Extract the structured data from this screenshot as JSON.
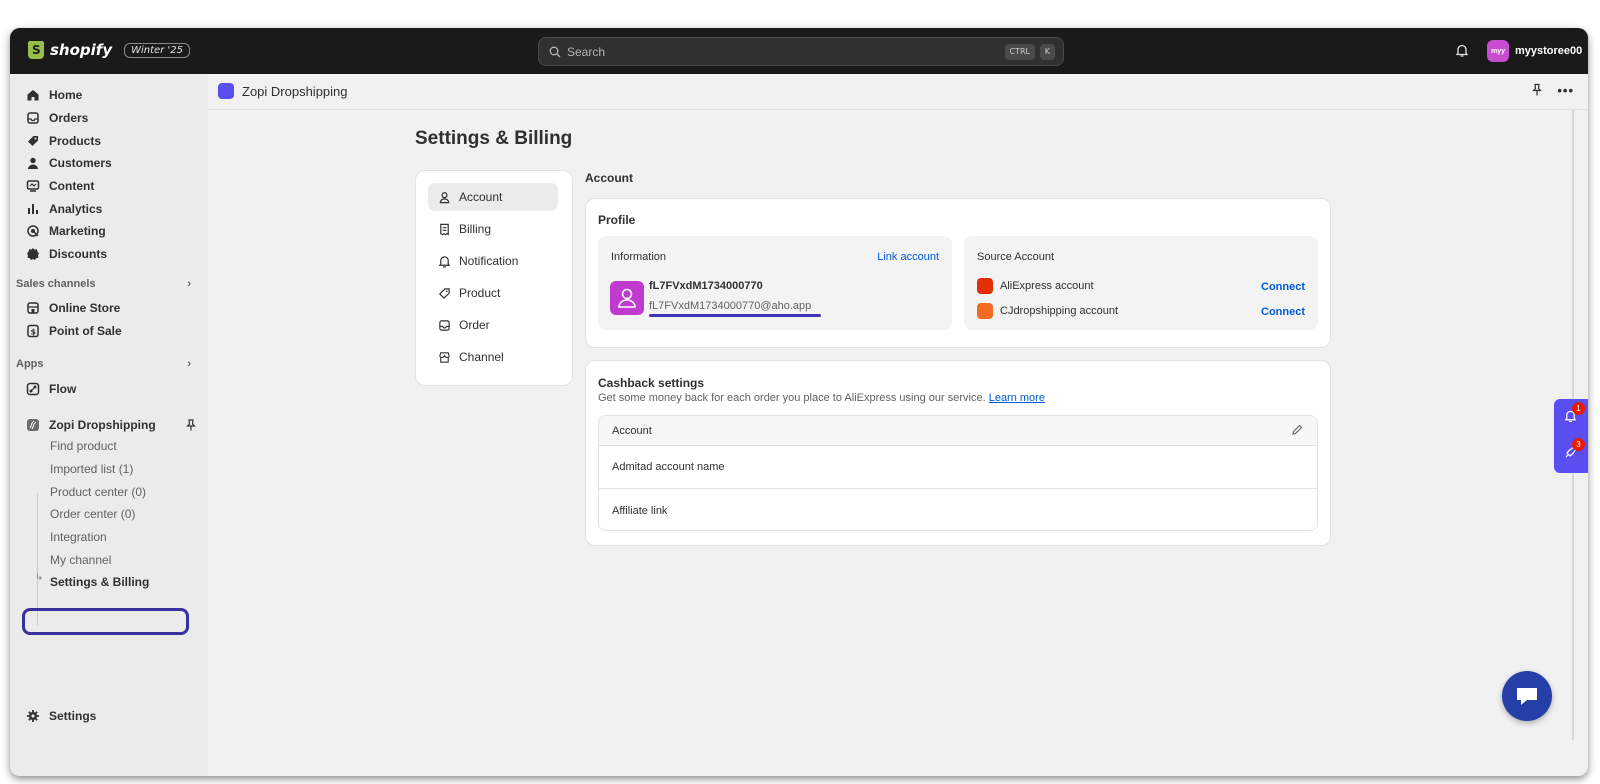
{
  "topbar": {
    "brand": "shopify",
    "edition": "Winter '25",
    "search_placeholder": "Search",
    "kbd_ctrl": "CTRL",
    "kbd_k": "K",
    "store_initials": "myy",
    "store_name": "myystoree00"
  },
  "sidebar": {
    "main": [
      {
        "label": "Home",
        "icon": "home-icon"
      },
      {
        "label": "Orders",
        "icon": "inbox-icon"
      },
      {
        "label": "Products",
        "icon": "tag-icon"
      },
      {
        "label": "Customers",
        "icon": "person-icon"
      },
      {
        "label": "Content",
        "icon": "content-icon"
      },
      {
        "label": "Analytics",
        "icon": "bar-chart-icon"
      },
      {
        "label": "Marketing",
        "icon": "target-icon"
      },
      {
        "label": "Discounts",
        "icon": "discount-icon"
      }
    ],
    "sales_channels_label": "Sales channels",
    "sales_channels": [
      {
        "label": "Online Store",
        "icon": "store-icon"
      },
      {
        "label": "Point of Sale",
        "icon": "pos-icon"
      }
    ],
    "apps_label": "Apps",
    "apps": [
      {
        "label": "Flow",
        "icon": "flow-icon"
      }
    ],
    "zopi_label": "Zopi Dropshipping",
    "zopi_sub": [
      "Find product",
      "Imported list (1)",
      "Product center (0)",
      "Order center (0)",
      "Integration",
      "My channel",
      "Settings & Billing"
    ],
    "settings_label": "Settings"
  },
  "app_header": {
    "title": "Zopi Dropshipping"
  },
  "page": {
    "title": "Settings & Billing"
  },
  "settings_menu": [
    "Account",
    "Billing",
    "Notification",
    "Product",
    "Order",
    "Channel"
  ],
  "account": {
    "section_title": "Account",
    "profile_title": "Profile",
    "information_label": "Information",
    "link_account": "Link account",
    "username": "fL7FVxdM1734000770",
    "email": "fL7FVxdM1734000770@aho.app",
    "source_account_label": "Source Account",
    "sources": [
      {
        "name": "AliExpress account",
        "action": "Connect",
        "color": "#e62e04"
      },
      {
        "name": "CJdropshipping account",
        "action": "Connect",
        "color": "#f26b21"
      }
    ]
  },
  "cashback": {
    "title": "Cashback settings",
    "description": "Get some money back for each order you place to AliExpress using our service.",
    "learn_more": "Learn more",
    "table_header": "Account",
    "rows": [
      "Admitad account name",
      "Affiliate link"
    ]
  },
  "floating": {
    "notif_count": "1",
    "rocket_count": "3"
  },
  "colors": {
    "accent": "#5b4ef0",
    "link": "#005bd3",
    "topbar": "#1a1a1a"
  }
}
